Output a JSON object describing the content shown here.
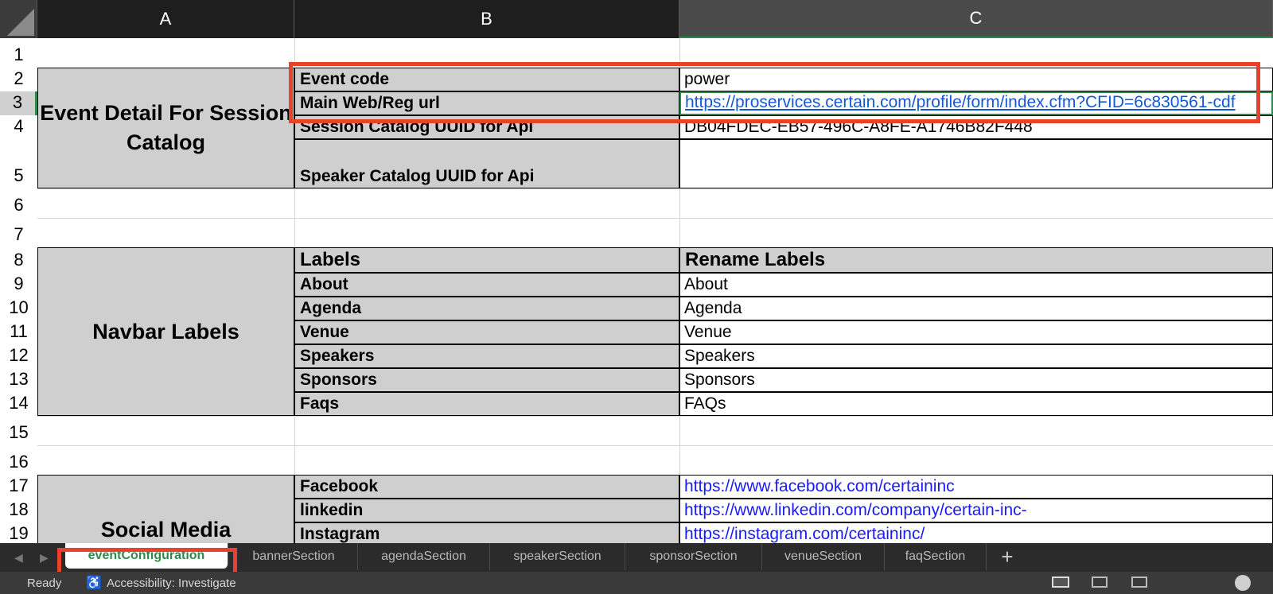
{
  "columns": [
    "A",
    "B",
    "C"
  ],
  "rows": [
    "1",
    "2",
    "3",
    "4",
    "5",
    "6",
    "7",
    "8",
    "9",
    "10",
    "11",
    "12",
    "13",
    "14",
    "15",
    "16",
    "17",
    "18",
    "19"
  ],
  "event_detail": {
    "section_title": "Event Detail For Session Catalog",
    "rows": [
      {
        "label": "Event code",
        "value": "power"
      },
      {
        "label": "Main Web/Reg url",
        "value": "https://proservices.certain.com/profile/form/index.cfm?CFID=6c830561-cdf"
      },
      {
        "label": "Session Catalog UUID for Api",
        "value": "DB04FDEC-EB57-496C-A8FE-A1746B82F448"
      },
      {
        "label": "Speaker Catalog UUID for Api",
        "value": ""
      }
    ]
  },
  "navbar": {
    "section_title": "Navbar Labels",
    "header_label": "Labels",
    "header_rename": "Rename Labels",
    "rows": [
      {
        "label": "About",
        "value": "About"
      },
      {
        "label": "Agenda",
        "value": "Agenda"
      },
      {
        "label": "Venue",
        "value": "Venue"
      },
      {
        "label": "Speakers",
        "value": "Speakers"
      },
      {
        "label": "Sponsors",
        "value": "Sponsors"
      },
      {
        "label": "Faqs",
        "value": "FAQs"
      }
    ]
  },
  "social": {
    "section_title": "Social Media",
    "rows": [
      {
        "label": "Facebook",
        "value": "https://www.facebook.com/certaininc"
      },
      {
        "label": "linkedin",
        "value": "https://www.linkedin.com/company/certain-inc-"
      },
      {
        "label": "Instagram",
        "value": "https://instagram.com/certaininc/"
      }
    ]
  },
  "sheet_tabs": [
    "eventConfiguration",
    "bannerSection",
    "agendaSection",
    "speakerSection",
    "sponsorSection",
    "venueSection",
    "faqSection"
  ],
  "add_tab_label": "+",
  "status": {
    "ready": "Ready",
    "accessibility": "Accessibility: Investigate"
  },
  "colors": {
    "highlight": "#e8432a",
    "active_tab": "#2f8a4a",
    "section_fill": "#cfcfcf"
  }
}
